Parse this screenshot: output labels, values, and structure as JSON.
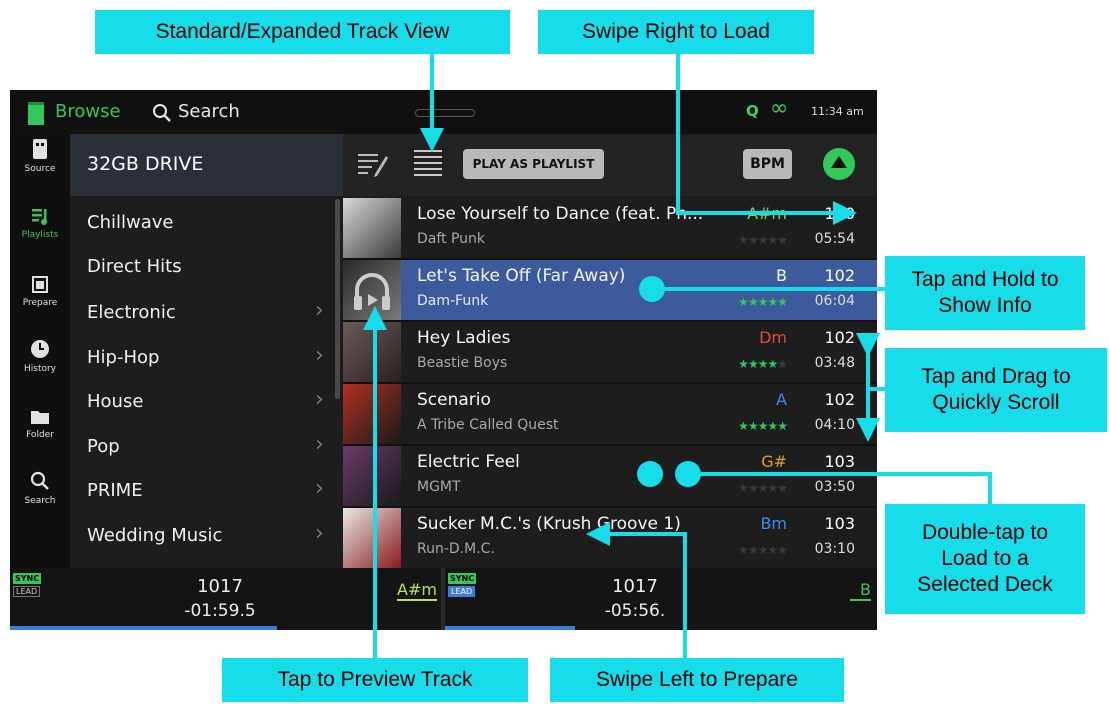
{
  "callouts": {
    "standard_view": "Standard/Expanded Track View",
    "swipe_right": "Swipe Right to Load",
    "tap_hold": "Tap and Hold to Show Info",
    "tap_drag": "Tap and Drag to Quickly Scroll",
    "double_tap": "Double-tap to Load to a Selected Deck",
    "tap_preview": "Tap to Preview Track",
    "swipe_left": "Swipe Left to Prepare"
  },
  "topbar": {
    "browse": "Browse",
    "search": "Search",
    "q": "Q",
    "clock": "11:34 am"
  },
  "sidebar": {
    "items": [
      {
        "label": "Source",
        "icon": "usb-drive-icon"
      },
      {
        "label": "Playlists",
        "icon": "playlist-icon"
      },
      {
        "label": "Prepare",
        "icon": "prepare-icon"
      },
      {
        "label": "History",
        "icon": "clock-icon"
      },
      {
        "label": "Folder",
        "icon": "folder-icon"
      },
      {
        "label": "Search",
        "icon": "search-icon"
      }
    ]
  },
  "crates": {
    "drive": "32GB DRIVE",
    "items": [
      "Chillwave",
      "Direct Hits",
      "Electronic",
      "Hip-Hop",
      "House",
      "Pop",
      "PRIME",
      "Wedding Music"
    ]
  },
  "tracklist": {
    "play_as_playlist": "PLAY AS PLAYLIST",
    "bpm_button": "BPM",
    "rows": [
      {
        "title": "Lose Yourself to Dance (feat. Ph...",
        "artist": "Daft Punk",
        "key": "A#m",
        "key_color": "#8fd14f",
        "rating": 0,
        "bpm": "100",
        "duration": "05:54"
      },
      {
        "title": "Let's Take Off (Far Away)",
        "artist": "Dam-Funk",
        "key": "B",
        "key_color": "#ffffff",
        "rating": 5,
        "bpm": "102",
        "duration": "06:04"
      },
      {
        "title": "Hey Ladies",
        "artist": "Beastie Boys",
        "key": "Dm",
        "key_color": "#e84a3c",
        "rating": 4,
        "bpm": "102",
        "duration": "03:48"
      },
      {
        "title": "Scenario",
        "artist": "A Tribe Called Quest",
        "key": "A",
        "key_color": "#3a8ee6",
        "rating": 5,
        "bpm": "102",
        "duration": "04:10"
      },
      {
        "title": "Electric Feel",
        "artist": "MGMT",
        "key": "G#",
        "key_color": "#e0a020",
        "rating": 0,
        "bpm": "103",
        "duration": "03:50"
      },
      {
        "title": "Sucker M.C.'s (Krush Groove 1)",
        "artist": "Run-D.M.C.",
        "key": "Bm",
        "key_color": "#3a8ee6",
        "rating": 0,
        "bpm": "103",
        "duration": "03:10"
      }
    ]
  },
  "decks": {
    "left": {
      "sync": "SYNC",
      "lead": "LEAD",
      "bpm": "1017",
      "time": "-01:59.5",
      "key": "A#m",
      "key_color": "#b6e34a",
      "progress": 0.62
    },
    "right": {
      "sync": "SYNC",
      "lead": "LEAD",
      "bpm": "1017",
      "time": "-05:56.",
      "key": "B",
      "key_color": "#34c759",
      "progress": 0.3
    }
  },
  "colors": {
    "accent": "#34c759",
    "callout": "#17dcea",
    "selected_row": "#3c5a9c"
  }
}
